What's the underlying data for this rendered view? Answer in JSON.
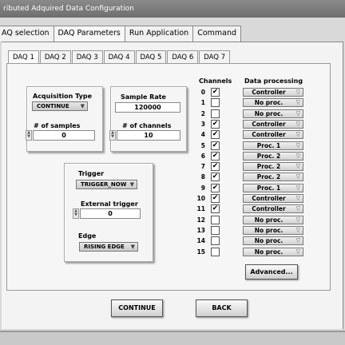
{
  "window": {
    "title": "ributed Adquired Data Configuration"
  },
  "main_tabs": [
    {
      "label": "AQ selection"
    },
    {
      "label": "DAQ Parameters"
    },
    {
      "label": "Run Application"
    },
    {
      "label": "Command"
    }
  ],
  "daq_tabs": [
    {
      "label": "DAQ 1"
    },
    {
      "label": "DAQ 2"
    },
    {
      "label": "DAQ 3"
    },
    {
      "label": "DAQ 4"
    },
    {
      "label": "DAQ 5"
    },
    {
      "label": "DAQ 6"
    },
    {
      "label": "DAQ 7"
    }
  ],
  "acquisition": {
    "type_label": "Acquisition Type",
    "type_value": "CONTINUE",
    "samples_label": "# of samples",
    "samples_value": "0"
  },
  "sampling": {
    "rate_label": "Sample Rate",
    "rate_value": "120000",
    "channels_label": "# of channels",
    "channels_value": "10"
  },
  "trigger": {
    "trigger_label": "Trigger",
    "trigger_value": "TRIGGER_NOW",
    "external_label": "External trigger",
    "external_value": "0",
    "edge_label": "Edge",
    "edge_value": "RISING EDGE"
  },
  "channels": {
    "header_channels": "Channels",
    "header_processing": "Data processing",
    "checkmark": "✔",
    "rows": [
      {
        "num": "0",
        "checked": true,
        "processing": "Controller"
      },
      {
        "num": "1",
        "checked": false,
        "processing": "No proc."
      },
      {
        "num": "2",
        "checked": false,
        "processing": "No proc."
      },
      {
        "num": "3",
        "checked": true,
        "processing": "Controller"
      },
      {
        "num": "4",
        "checked": true,
        "processing": "Controller"
      },
      {
        "num": "5",
        "checked": true,
        "processing": "Proc. 1"
      },
      {
        "num": "6",
        "checked": true,
        "processing": "Proc. 2"
      },
      {
        "num": "7",
        "checked": true,
        "processing": "Proc. 2"
      },
      {
        "num": "8",
        "checked": true,
        "processing": "Proc. 2"
      },
      {
        "num": "9",
        "checked": true,
        "processing": "Proc. 1"
      },
      {
        "num": "10",
        "checked": true,
        "processing": "Controller"
      },
      {
        "num": "11",
        "checked": true,
        "processing": "Controller"
      },
      {
        "num": "12",
        "checked": false,
        "processing": "No proc."
      },
      {
        "num": "13",
        "checked": false,
        "processing": "No proc."
      },
      {
        "num": "14",
        "checked": false,
        "processing": "No proc."
      },
      {
        "num": "15",
        "checked": false,
        "processing": "No proc."
      }
    ]
  },
  "buttons": {
    "advanced": "Advanced...",
    "continue": "CONTINUE",
    "back": "BACK"
  },
  "icons": {
    "dropdown": "chevron-down-icon",
    "spinner": "spinner-arrows-icon",
    "checkbox": "check-icon"
  }
}
